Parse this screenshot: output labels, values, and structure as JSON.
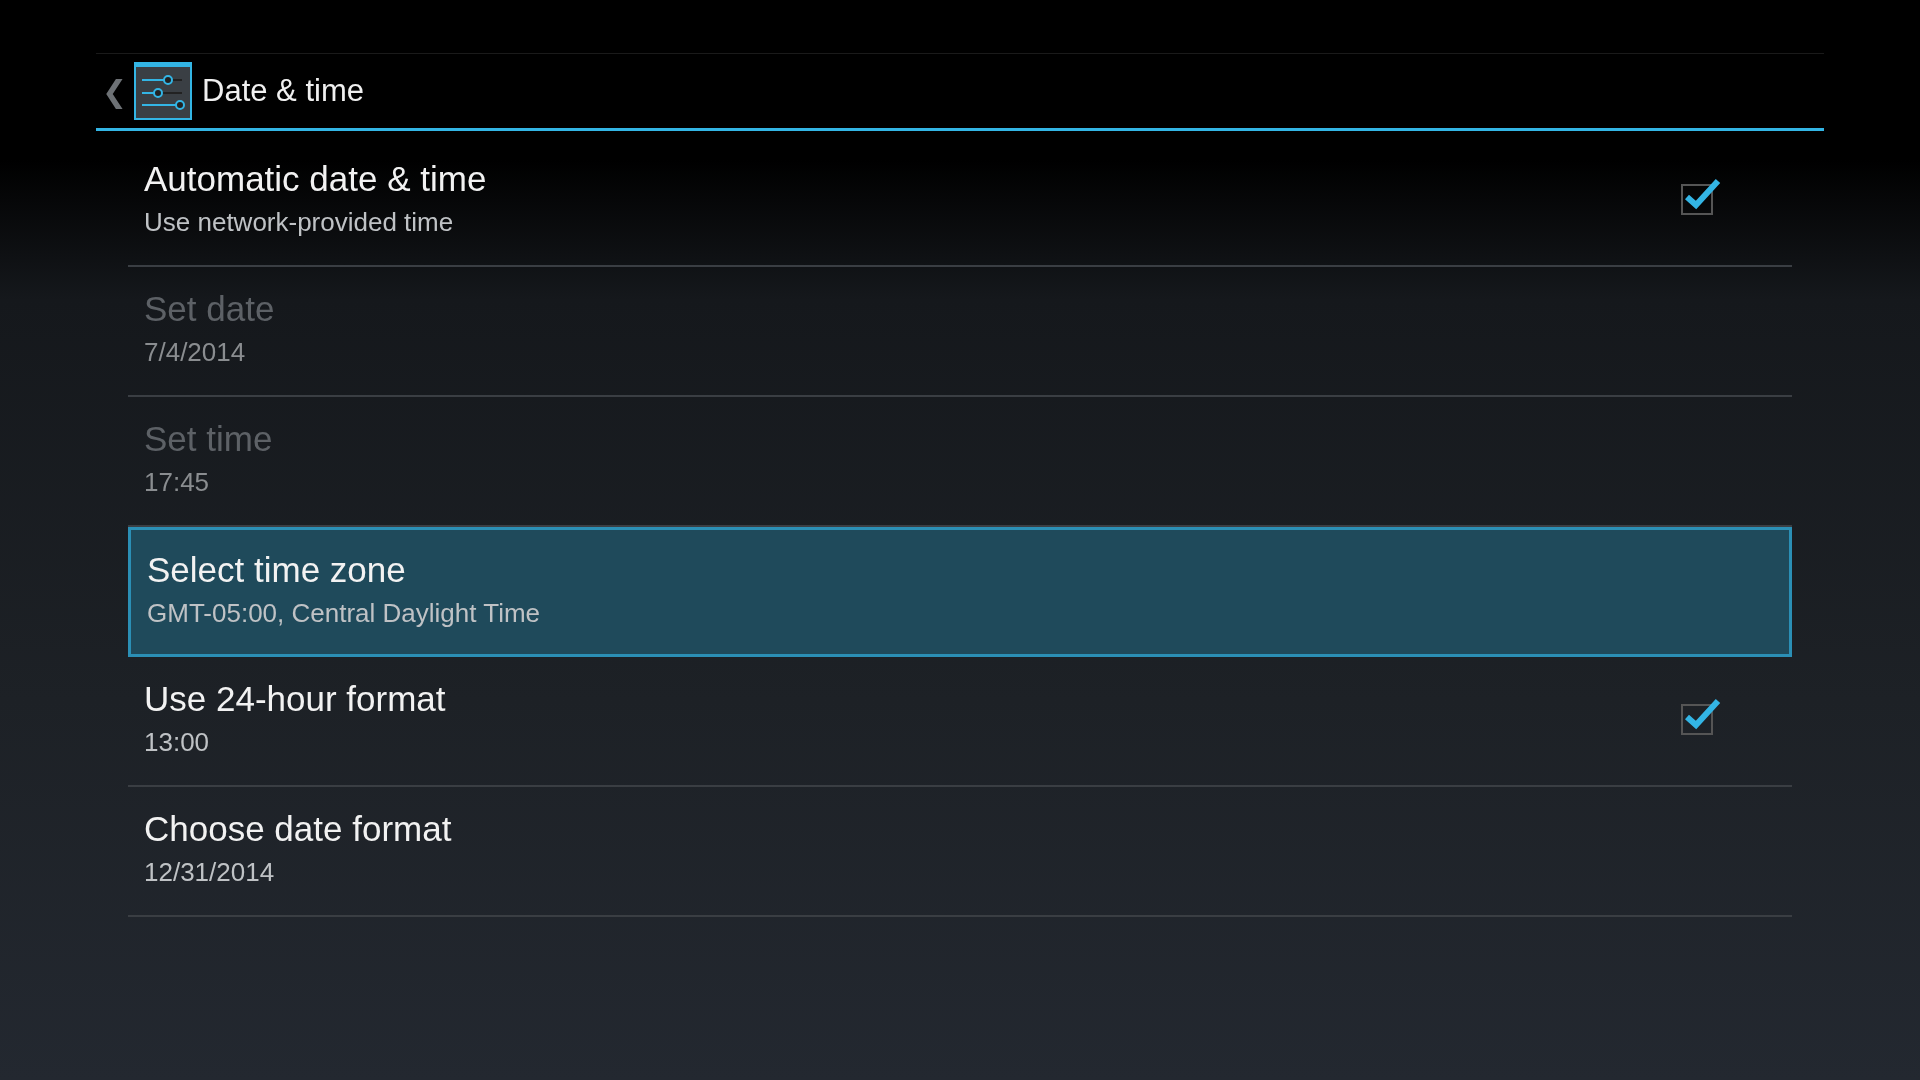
{
  "header": {
    "back": "❮",
    "title": "Date & time"
  },
  "settings": [
    {
      "kind": "checkbox",
      "title": "Automatic date & time",
      "summary": "Use network-provided time",
      "checked": true,
      "disabled": false,
      "selected": false
    },
    {
      "kind": "plain",
      "title": "Set date",
      "summary": "7/4/2014",
      "disabled": true,
      "selected": false
    },
    {
      "kind": "plain",
      "title": "Set time",
      "summary": "17:45",
      "disabled": true,
      "selected": false
    },
    {
      "kind": "plain",
      "title": "Select time zone",
      "summary": "GMT-05:00, Central Daylight Time",
      "disabled": false,
      "selected": true
    },
    {
      "kind": "checkbox",
      "title": "Use 24-hour format",
      "summary": "13:00",
      "checked": true,
      "disabled": false,
      "selected": false
    },
    {
      "kind": "plain",
      "title": "Choose date format",
      "summary": "12/31/2014",
      "disabled": false,
      "selected": false
    }
  ]
}
